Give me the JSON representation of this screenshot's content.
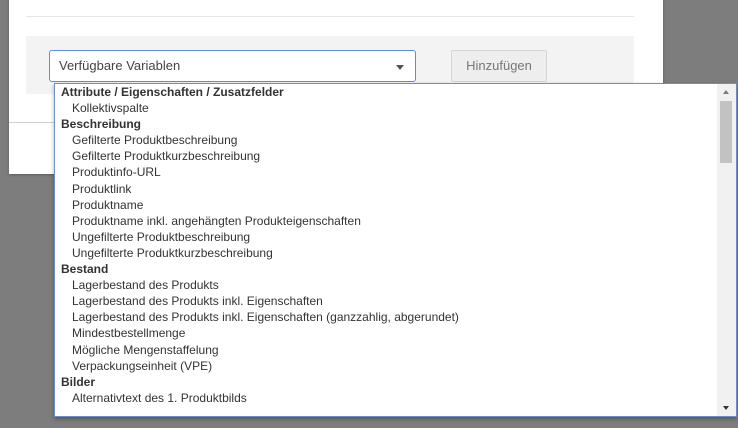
{
  "colors": {
    "backdrop": "#7d7d7d",
    "select_border": "#5b8fd6",
    "dropdown_border": "#6a8fc9",
    "panel_bg": "#f3f3f3"
  },
  "toolbar": {
    "select_value": "Verfügbare Variablen",
    "add_button_label": "Hinzufügen",
    "caret_icon": "chevron-down-icon"
  },
  "dropdown": {
    "groups": [
      {
        "label": "Attribute / Eigenschaften / Zusatzfelder",
        "options": [
          "Kollektivspalte"
        ]
      },
      {
        "label": "Beschreibung",
        "options": [
          "Gefilterte Produktbeschreibung",
          "Gefilterte Produktkurzbeschreibung",
          "Produktinfo-URL",
          "Produktlink",
          "Produktname",
          "Produktname inkl. angehängten Produkteigenschaften",
          "Ungefilterte Produktbeschreibung",
          "Ungefilterte Produktkurzbeschreibung"
        ]
      },
      {
        "label": "Bestand",
        "options": [
          "Lagerbestand des Produkts",
          "Lagerbestand des Produkts inkl. Eigenschaften",
          "Lagerbestand des Produkts inkl. Eigenschaften (ganzzahlig, abgerundet)",
          "Mindestbestellmenge",
          "Mögliche Mengenstaffelung",
          "Verpackungseinheit (VPE)"
        ]
      },
      {
        "label": "Bilder",
        "options": [
          "Alternativtext des 1. Produktbilds"
        ]
      }
    ],
    "scrollbar": {
      "up_icon": "scroll-up-arrow-icon",
      "down_icon": "scroll-down-arrow-icon"
    }
  }
}
